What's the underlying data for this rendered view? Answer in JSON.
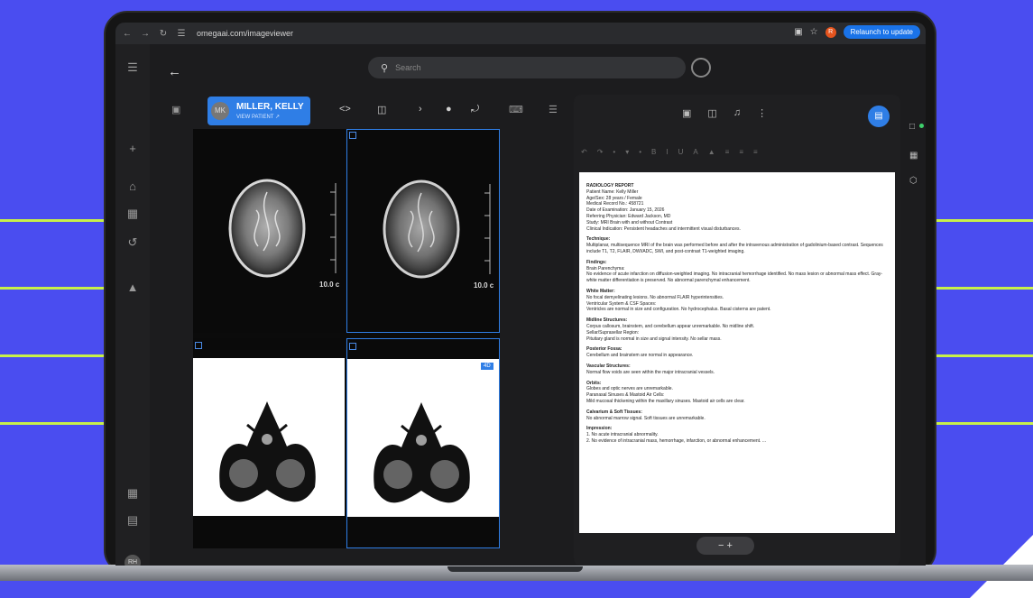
{
  "browser": {
    "url": "omegaai.com/imageviewer",
    "relaunch_label": "Relaunch to update",
    "profile_initial": "R"
  },
  "app": {
    "search_placeholder": "Search",
    "user_initials": "RH"
  },
  "patient": {
    "initials": "MK",
    "name": "MILLER, KELLY",
    "view_label": "VIEW PATIENT ↗"
  },
  "viewer": {
    "scale_labels": [
      "10.0 c",
      "10.0 c"
    ],
    "tile_badge": "4D"
  },
  "report": {
    "lines": [
      {
        "type": "h",
        "text": "RADIOLOGY REPORT"
      },
      {
        "type": "p",
        "text": "Patient Name: Kelly Miller"
      },
      {
        "type": "p",
        "text": "Age/Sex: 28 years / Female"
      },
      {
        "type": "p",
        "text": "Medical Record No.: 458721"
      },
      {
        "type": "p",
        "text": "Date of Examination: January 15, 2026"
      },
      {
        "type": "p",
        "text": "Referring Physician: Edward Jackson, MD"
      },
      {
        "type": "p",
        "text": "Study: MRI Brain with and without Contrast"
      },
      {
        "type": "p",
        "text": "Clinical Indication: Persistent headaches and intermittent visual disturbances."
      },
      {
        "type": "h",
        "text": "Technique:"
      },
      {
        "type": "p",
        "text": "Multiplanar, multisequence MRI of the brain was performed before and after the intravenous administration of gadolinium-based contrast. Sequences include T1, T2, FLAIR, DWI/ADC, SWI, and post-contrast T1-weighted imaging."
      },
      {
        "type": "h",
        "text": "Findings:"
      },
      {
        "type": "p",
        "text": "Brain Parenchyma:"
      },
      {
        "type": "p",
        "text": " No evidence of acute infarction on diffusion-weighted imaging. No intracranial hemorrhage identified. No mass lesion or abnormal mass effect. Gray-white matter differentiation is preserved. No abnormal parenchymal enhancement."
      },
      {
        "type": "h",
        "text": "White Matter:"
      },
      {
        "type": "p",
        "text": "No focal demyelinating lesions. No abnormal FLAIR hyperintensities."
      },
      {
        "type": "p",
        "text": "Ventricular System & CSF Spaces:"
      },
      {
        "type": "p",
        "text": " Ventricles are normal in size and configuration. No hydrocephalus. Basal cisterns are patent."
      },
      {
        "type": "h",
        "text": "Midline Structures:"
      },
      {
        "type": "p",
        "text": " Corpus callosum, brainstem, and cerebellum appear unremarkable. No midline shift."
      },
      {
        "type": "p",
        "text": "Sellar/Suprasellar Region:"
      },
      {
        "type": "p",
        "text": " Pituitary gland is normal in size and signal intensity. No sellar mass."
      },
      {
        "type": "h",
        "text": "Posterior Fossa:"
      },
      {
        "type": "p",
        "text": " Cerebellum and brainstem are normal in appearance."
      },
      {
        "type": "h",
        "text": "Vascular Structures:"
      },
      {
        "type": "p",
        "text": " Normal flow voids are seen within the major intracranial vessels."
      },
      {
        "type": "h",
        "text": "Orbits:"
      },
      {
        "type": "p",
        "text": "Globes and optic nerves are unremarkable."
      },
      {
        "type": "p",
        "text": "Paranasal Sinuses & Mastoid Air Cells:"
      },
      {
        "type": "p",
        "text": "Mild mucosal thickening within the maxillary sinuses. Mastoid air cells are clear."
      },
      {
        "type": "h",
        "text": "Calvarium & Soft Tissues:"
      },
      {
        "type": "p",
        "text": " No abnormal marrow signal. Soft tissues are unremarkable."
      },
      {
        "type": "h",
        "text": "Impression:"
      },
      {
        "type": "p",
        "text": " 1. No acute intracranial abnormality."
      },
      {
        "type": "p",
        "text": " 2. No evidence of intracranial mass, hemorrhage, infarction, or abnormal enhancement. ..."
      }
    ],
    "zoom_label": "−  +"
  },
  "icons": {
    "back": "arrow-left-icon",
    "search": "search-icon",
    "menu": "hamburger-icon"
  },
  "colors": {
    "background": "#4a4df0",
    "accent": "#2f7ee6",
    "stripes": "#c8f04a"
  }
}
